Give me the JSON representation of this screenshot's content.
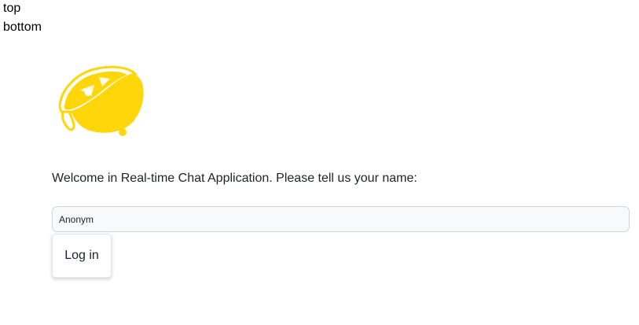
{
  "debug": {
    "top_label": "top",
    "bottom_label": "bottom"
  },
  "logo": {
    "icon": "lemon-logo-icon",
    "color": "#FFD60A"
  },
  "login": {
    "welcome_text": "Welcome in Real-time Chat Application. Please tell us your name:",
    "name_value": "Anonym",
    "button_label": "Log in"
  }
}
